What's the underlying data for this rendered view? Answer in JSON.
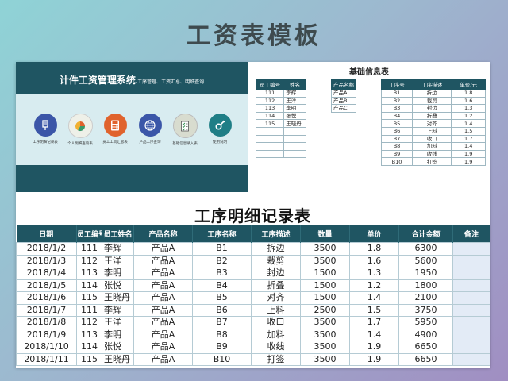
{
  "page_title": "工资表模板",
  "dashboard": {
    "title": "计件工资管理系统",
    "subtitle": "-工序管理、工资汇总、明细查询",
    "items": [
      {
        "label": "工序明细记录表",
        "icon": "clipboard-pen-icon",
        "color": "#3b56a8"
      },
      {
        "label": "个人明细查询表",
        "icon": "pie-chart-icon",
        "color": "#eef0e8"
      },
      {
        "label": "员工工资汇总表",
        "icon": "calculator-icon",
        "color": "#e0632d"
      },
      {
        "label": "产品工序查询",
        "icon": "globe-icon",
        "color": "#3b56a8"
      },
      {
        "label": "基础信息录入表",
        "icon": "checklist-icon",
        "color": "#d8dccf"
      },
      {
        "label": "使用说明",
        "icon": "gear-icon",
        "color": "#1f7e86"
      }
    ]
  },
  "info": {
    "title": "基础信息表",
    "employees": {
      "headers": [
        "员工编号",
        "姓名"
      ],
      "rows": [
        [
          "111",
          "李辉"
        ],
        [
          "112",
          "王洋"
        ],
        [
          "113",
          "李明"
        ],
        [
          "114",
          "张悦"
        ],
        [
          "115",
          "王晓丹"
        ],
        [
          "",
          ""
        ],
        [
          "",
          ""
        ],
        [
          "",
          ""
        ],
        [
          "",
          ""
        ]
      ]
    },
    "products": {
      "headers": [
        "产品名称"
      ],
      "rows": [
        [
          "产品A"
        ],
        [
          "产品B"
        ],
        [
          "产品C"
        ]
      ]
    },
    "processes": {
      "headers": [
        "工序号",
        "工序描述",
        "单价/元"
      ],
      "rows": [
        [
          "B1",
          "拆边",
          "1.8"
        ],
        [
          "B2",
          "裁剪",
          "1.6"
        ],
        [
          "B3",
          "封边",
          "1.3"
        ],
        [
          "B4",
          "折叠",
          "1.2"
        ],
        [
          "B5",
          "对齐",
          "1.4"
        ],
        [
          "B6",
          "上料",
          "1.5"
        ],
        [
          "B7",
          "收口",
          "1.7"
        ],
        [
          "B8",
          "加料",
          "1.4"
        ],
        [
          "B9",
          "收线",
          "1.9"
        ],
        [
          "B10",
          "打签",
          "1.9"
        ]
      ]
    }
  },
  "detail": {
    "title": "工序明细记录表",
    "headers": [
      "日期",
      "员工编号",
      "员工姓名",
      "产品名称",
      "工序名称",
      "工序描述",
      "数量",
      "单价",
      "合计金额",
      "备注"
    ],
    "rows": [
      [
        "2018/1/2",
        "111",
        "李辉",
        "产品A",
        "B1",
        "拆边",
        "3500",
        "1.8",
        "6300",
        ""
      ],
      [
        "2018/1/3",
        "112",
        "王洋",
        "产品A",
        "B2",
        "裁剪",
        "3500",
        "1.6",
        "5600",
        ""
      ],
      [
        "2018/1/4",
        "113",
        "李明",
        "产品A",
        "B3",
        "封边",
        "1500",
        "1.3",
        "1950",
        ""
      ],
      [
        "2018/1/5",
        "114",
        "张悦",
        "产品A",
        "B4",
        "折叠",
        "1500",
        "1.2",
        "1800",
        ""
      ],
      [
        "2018/1/6",
        "115",
        "王晓丹",
        "产品A",
        "B5",
        "对齐",
        "1500",
        "1.4",
        "2100",
        ""
      ],
      [
        "2018/1/7",
        "111",
        "李辉",
        "产品A",
        "B6",
        "上料",
        "2500",
        "1.5",
        "3750",
        ""
      ],
      [
        "2018/1/8",
        "112",
        "王洋",
        "产品A",
        "B7",
        "收口",
        "3500",
        "1.7",
        "5950",
        ""
      ],
      [
        "2018/1/9",
        "113",
        "李明",
        "产品A",
        "B8",
        "加料",
        "3500",
        "1.4",
        "4900",
        ""
      ],
      [
        "2018/1/10",
        "114",
        "张悦",
        "产品A",
        "B9",
        "收线",
        "3500",
        "1.9",
        "6650",
        ""
      ],
      [
        "2018/1/11",
        "115",
        "王晓丹",
        "产品A",
        "B10",
        "打签",
        "3500",
        "1.9",
        "6650",
        ""
      ]
    ]
  }
}
